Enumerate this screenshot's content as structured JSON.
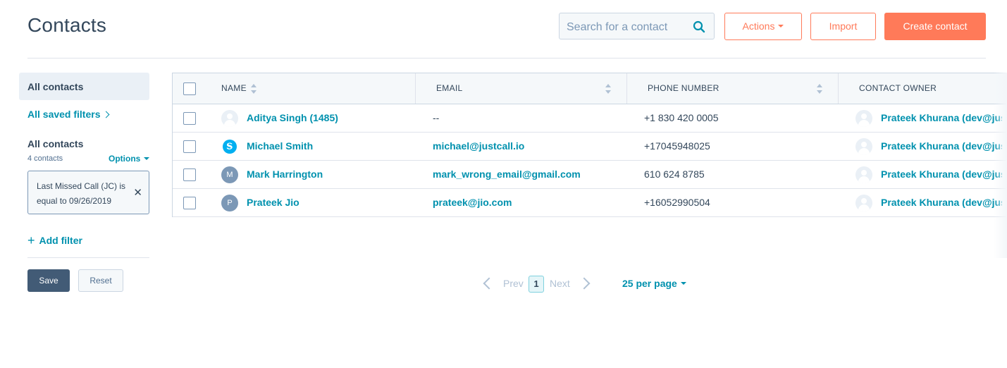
{
  "header": {
    "title": "Contacts",
    "search_placeholder": "Search for a contact",
    "actions_label": "Actions",
    "import_label": "Import",
    "create_label": "Create contact"
  },
  "sidebar": {
    "active_view": "All contacts",
    "saved_filters_label": "All saved filters",
    "view_heading": "All contacts",
    "count_label": "4 contacts",
    "options_label": "Options",
    "filter_text": "Last Missed Call (JC) is equal to 09/26/2019",
    "add_filter_label": "Add filter",
    "save_label": "Save",
    "reset_label": "Reset"
  },
  "table": {
    "columns": [
      "NAME",
      "EMAIL",
      "PHONE NUMBER",
      "CONTACT OWNER"
    ],
    "rows": [
      {
        "name": "Aditya Singh (1485)",
        "email": "--",
        "phone": "+1 830 420 0005",
        "owner": "Prateek Khurana (dev@justcall.io)",
        "avatar": "generic"
      },
      {
        "name": "Michael Smith",
        "email": "michael@justcall.io",
        "phone": "+17045948025",
        "owner": "Prateek Khurana (dev@justcall.io)",
        "avatar": "skype"
      },
      {
        "name": "Mark Harrington",
        "email": "mark_wrong_email@gmail.com",
        "phone": "610 624 8785",
        "owner": "Prateek Khurana (dev@justcall.io)",
        "avatar": "M"
      },
      {
        "name": "Prateek Jio",
        "email": "prateek@jio.com",
        "phone": "+16052990504",
        "owner": "Prateek Khurana (dev@justcall.io)",
        "avatar": "P"
      }
    ]
  },
  "pagination": {
    "prev_label": "Prev",
    "current_page": "1",
    "next_label": "Next",
    "per_page_label": "25 per page"
  },
  "colors": {
    "accent": "#ff7a59",
    "link": "#0091ae",
    "text": "#33475b",
    "save_button": "#425b76"
  }
}
